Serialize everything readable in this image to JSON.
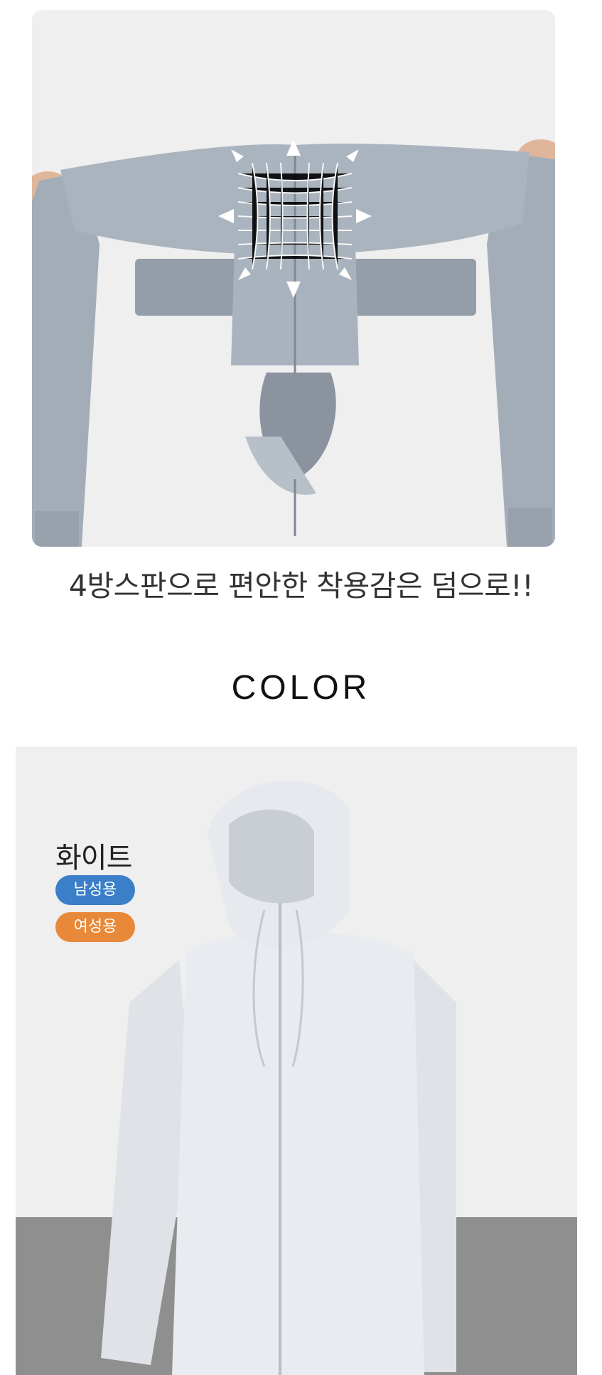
{
  "stretch_section": {
    "photo_icon": "stretch-jacket-photo",
    "caption": "4방스판으로 편안한 착용감은 덤으로!!"
  },
  "color_section": {
    "heading": "COLOR",
    "photo_icon": "hooded-jacket-photo",
    "color_name": "화이트",
    "badges": [
      {
        "label": "남성용",
        "color": "#3a7fc8"
      },
      {
        "label": "여성용",
        "color": "#e8893a"
      }
    ]
  }
}
